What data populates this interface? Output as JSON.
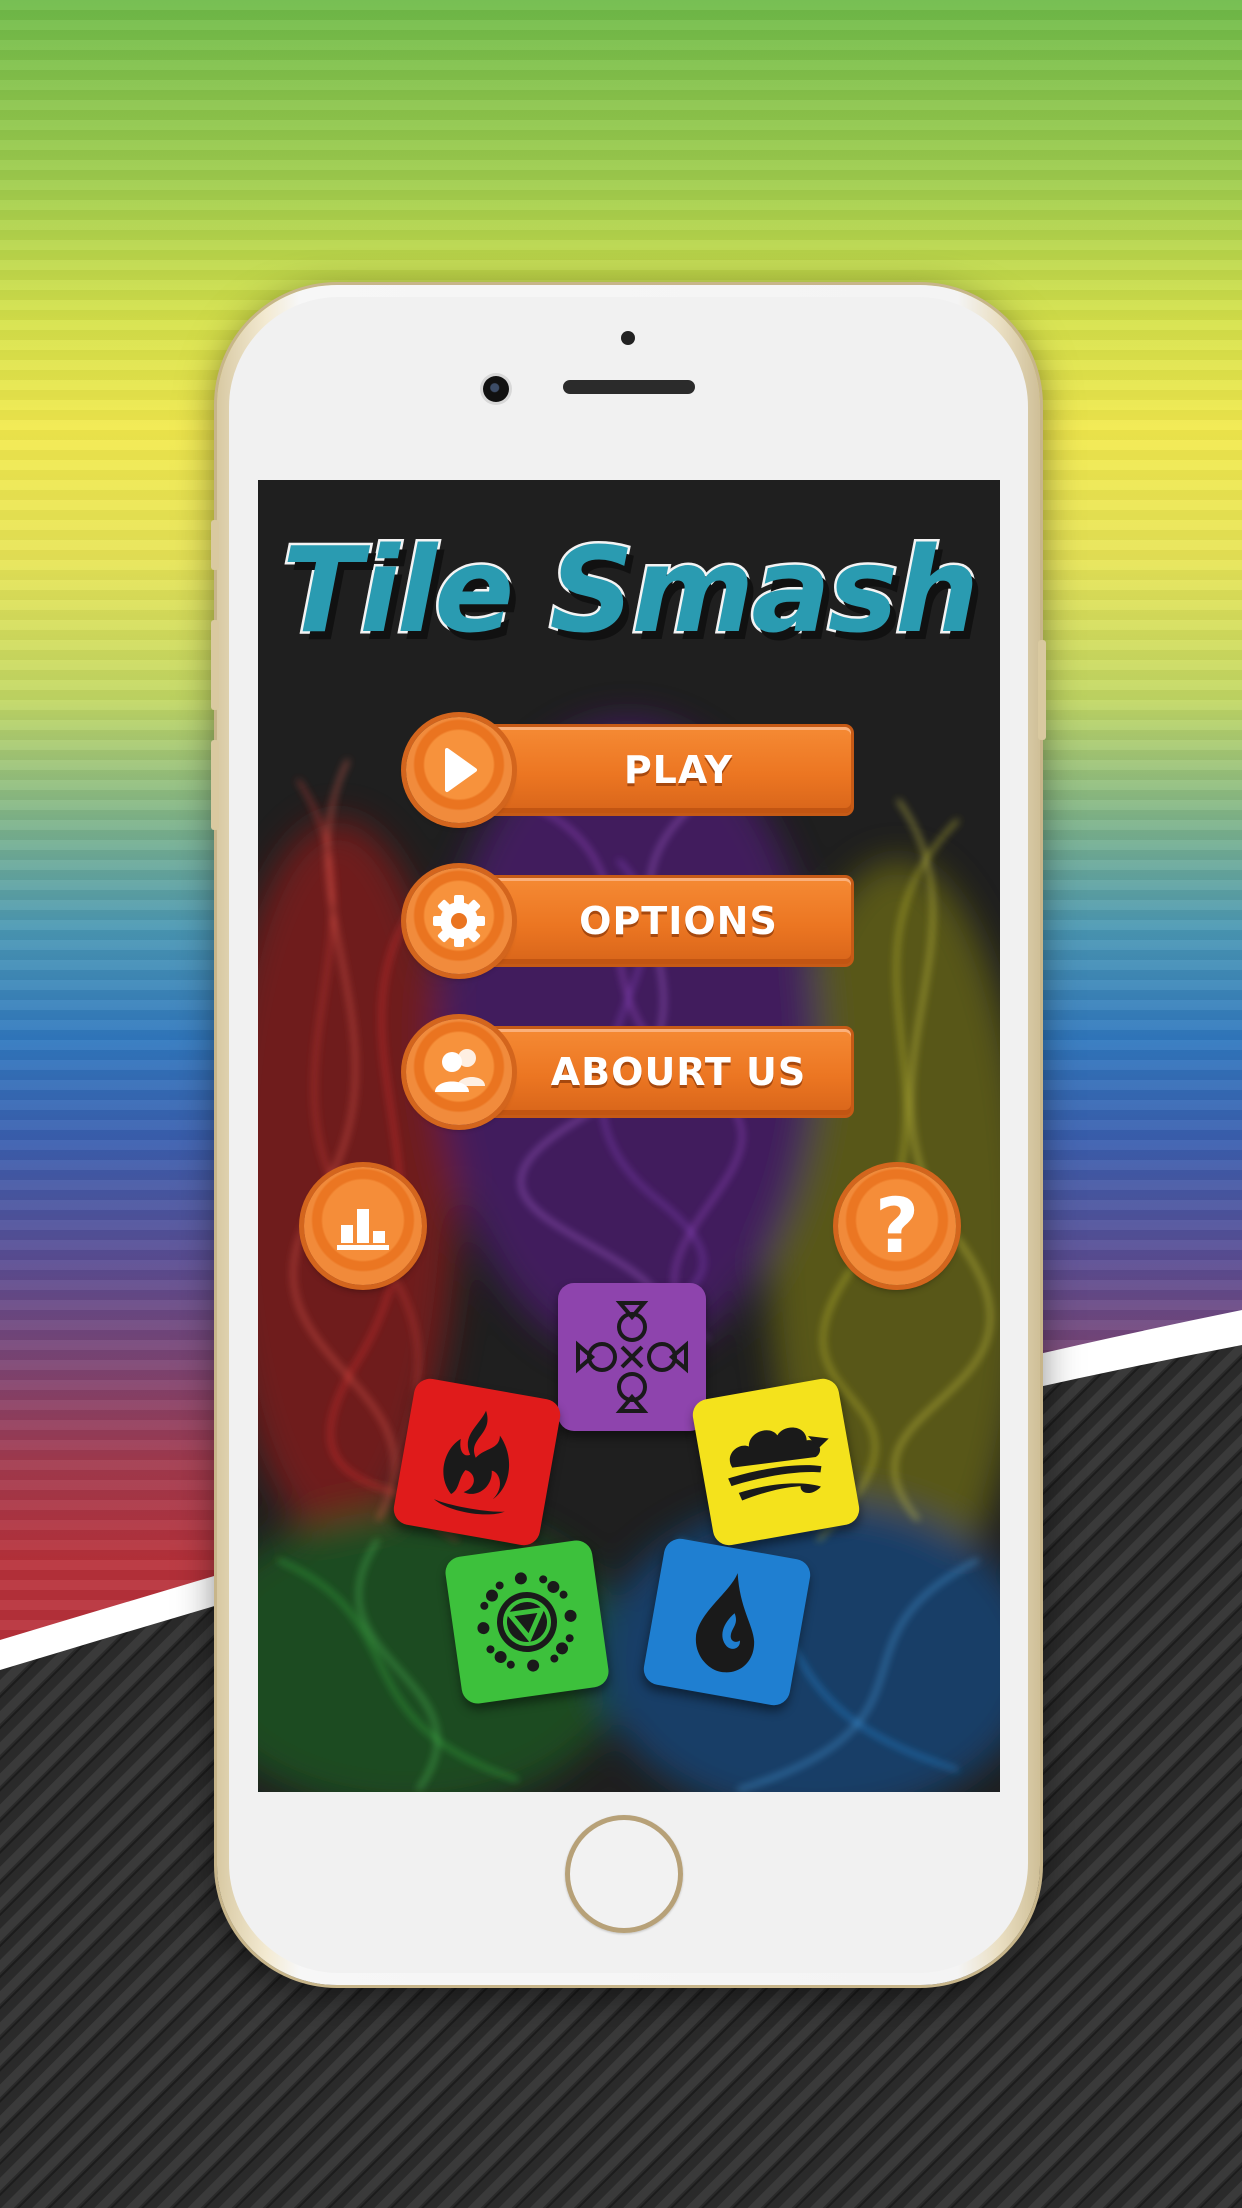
{
  "app": {
    "title": "Tile Smash"
  },
  "menu": {
    "play_label": "PLAY",
    "options_label": "OPTIONS",
    "about_label": "ABOURT US",
    "help_label": "?"
  },
  "icons": {
    "play": "play-icon",
    "options": "gear-icon",
    "about": "users-icon",
    "leaderboard": "leaderboard-icon",
    "help": "question-icon"
  },
  "tiles": [
    {
      "element": "spirit",
      "color": "#8e44ad",
      "icon": "spirit-icon"
    },
    {
      "element": "fire",
      "color": "#e01b1b",
      "icon": "fire-icon"
    },
    {
      "element": "air",
      "color": "#f4e21c",
      "icon": "cloud-icon"
    },
    {
      "element": "earth",
      "color": "#3dc13c",
      "icon": "sun-triangle-icon"
    },
    {
      "element": "water",
      "color": "#1f7fd1",
      "icon": "water-drop-icon"
    }
  ],
  "colors": {
    "button_orange": "#f07b24",
    "title_teal": "#2a9bb1",
    "screen_bg": "#1f1f1f"
  }
}
